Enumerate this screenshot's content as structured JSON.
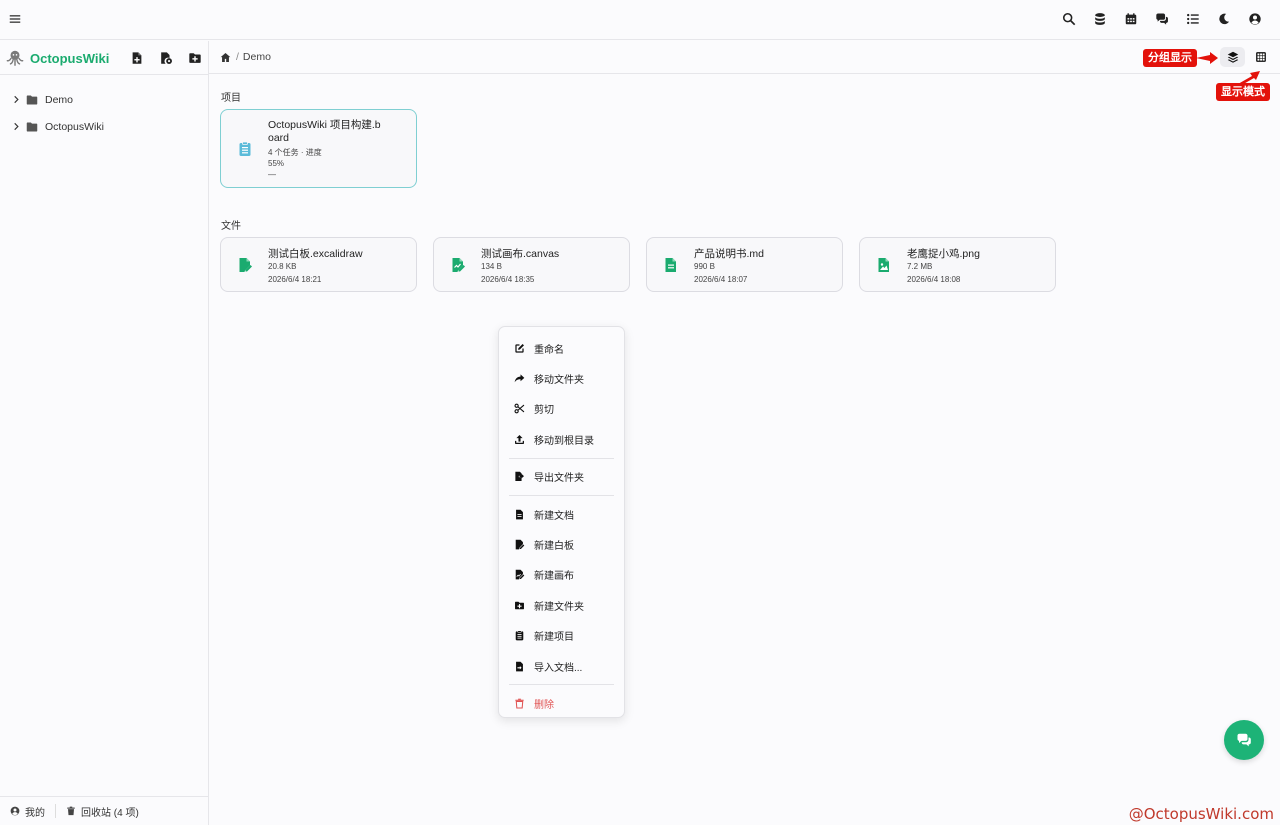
{
  "topbar": {
    "menu_icon": "hamburger-icon",
    "right_icons": [
      "search-icon",
      "database-icon",
      "calendar-icon",
      "comments-icon",
      "list-icon",
      "moon-icon",
      "user-circle-icon"
    ]
  },
  "sidebar": {
    "brand": "OctopusWiki",
    "actions": [
      "new-file-icon",
      "file-settings-icon",
      "new-folder-icon"
    ],
    "tree": [
      {
        "label": "Demo"
      },
      {
        "label": "OctopusWiki"
      }
    ],
    "footer": {
      "mine": "我的",
      "trash": "回收站 (4 项)"
    }
  },
  "breadcrumb": {
    "current": "Demo",
    "separator": "/"
  },
  "annotations": {
    "group_view": "分组显示",
    "display_mode": "显示模式"
  },
  "sections": {
    "projects_title": "项目",
    "files_title": "文件"
  },
  "project_card": {
    "title_line1": "OctopusWiki 项目构建.b",
    "title_line2": "oard",
    "tasks": "4 个任务 · 进度",
    "progress": "55%",
    "extra": "—"
  },
  "files": [
    {
      "name": "测试白板.excalidraw",
      "size": "20.8 KB",
      "time": "2026/6/4 18:21",
      "icon": "whiteboard-file-icon"
    },
    {
      "name": "测试画布.canvas",
      "size": "134 B",
      "time": "2026/6/4 18:35",
      "icon": "canvas-file-icon"
    },
    {
      "name": "产品说明书.md",
      "size": "990 B",
      "time": "2026/6/4 18:07",
      "icon": "document-file-icon"
    },
    {
      "name": "老鹰捉小鸡.png",
      "size": "7.2 MB",
      "time": "2026/6/4 18:08",
      "icon": "image-file-icon"
    }
  ],
  "context_menu": {
    "rename": "重命名",
    "move_folder": "移动文件夹",
    "cut": "剪切",
    "move_root": "移动到根目录",
    "export_folder": "导出文件夹",
    "new_doc": "新建文档",
    "new_whiteboard": "新建白板",
    "new_canvas": "新建画布",
    "new_folder": "新建文件夹",
    "new_project": "新建项目",
    "import_doc": "导入文档...",
    "delete": "删除"
  },
  "watermark": "@OctopusWiki.com",
  "colors": {
    "brand_green": "#1bab6f",
    "project_icon": "#5bbbd9",
    "danger": "#e05252",
    "callout_red": "#e3120b"
  }
}
